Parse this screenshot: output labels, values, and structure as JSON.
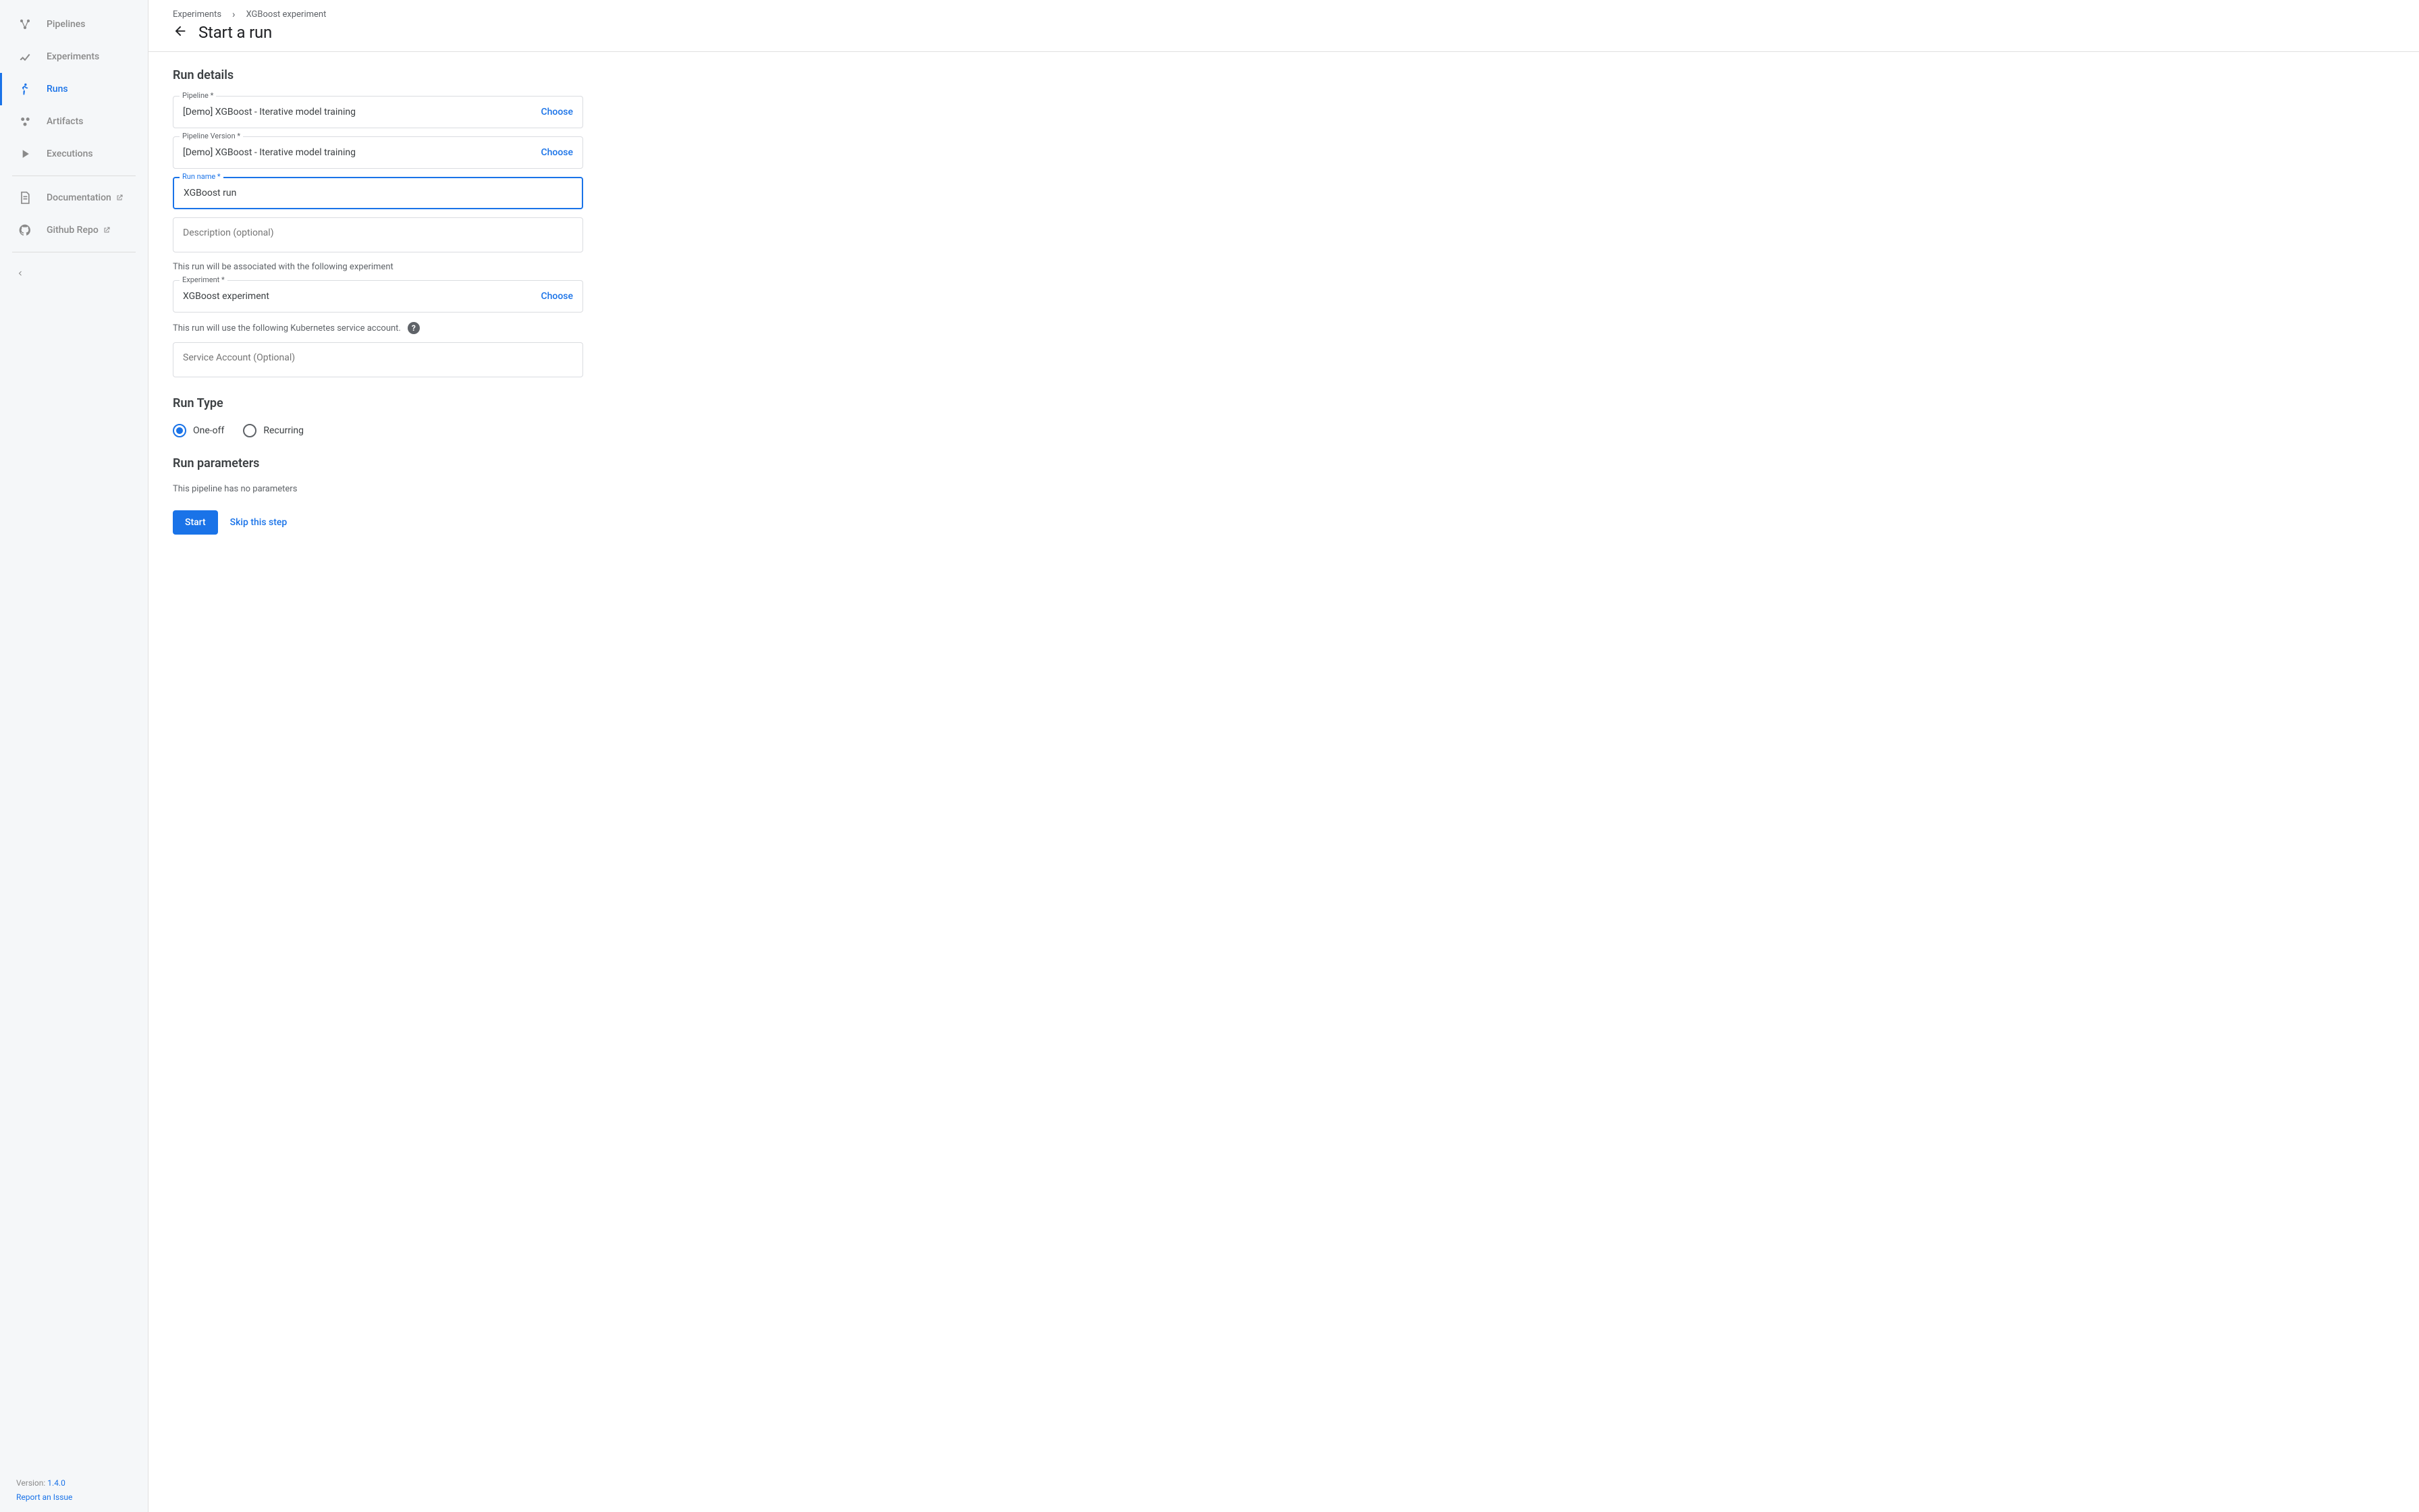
{
  "sidebar": {
    "items": [
      {
        "label": "Pipelines"
      },
      {
        "label": "Experiments"
      },
      {
        "label": "Runs"
      },
      {
        "label": "Artifacts"
      },
      {
        "label": "Executions"
      }
    ],
    "docs": {
      "label": "Documentation"
    },
    "github": {
      "label": "Github Repo"
    },
    "footer": {
      "version_label": "Version: ",
      "version_value": "1.4.0",
      "report_label": "Report an Issue"
    }
  },
  "breadcrumb": {
    "a": "Experiments",
    "b": "XGBoost experiment"
  },
  "header": {
    "title": "Start a run"
  },
  "sections": {
    "run_details": "Run details",
    "run_type": "Run Type",
    "run_parameters": "Run parameters"
  },
  "fields": {
    "pipeline": {
      "label": "Pipeline *",
      "value": "[Demo] XGBoost - Iterative model training",
      "choose": "Choose"
    },
    "pipeline_version": {
      "label": "Pipeline Version *",
      "value": "[Demo] XGBoost - Iterative model training",
      "choose": "Choose"
    },
    "run_name": {
      "label": "Run name *",
      "value": "XGBoost run"
    },
    "description": {
      "placeholder": "Description (optional)"
    },
    "experiment": {
      "label": "Experiment *",
      "value": "XGBoost experiment",
      "choose": "Choose"
    },
    "service_account": {
      "placeholder": "Service Account (Optional)"
    }
  },
  "info": {
    "experiment_assoc": "This run will be associated with the following experiment",
    "service_account": "This run will use the following Kubernetes service account."
  },
  "run_type": {
    "one_off": "One-off",
    "recurring": "Recurring"
  },
  "run_parameters": {
    "note": "This pipeline has no parameters"
  },
  "actions": {
    "start": "Start",
    "skip": "Skip this step"
  }
}
